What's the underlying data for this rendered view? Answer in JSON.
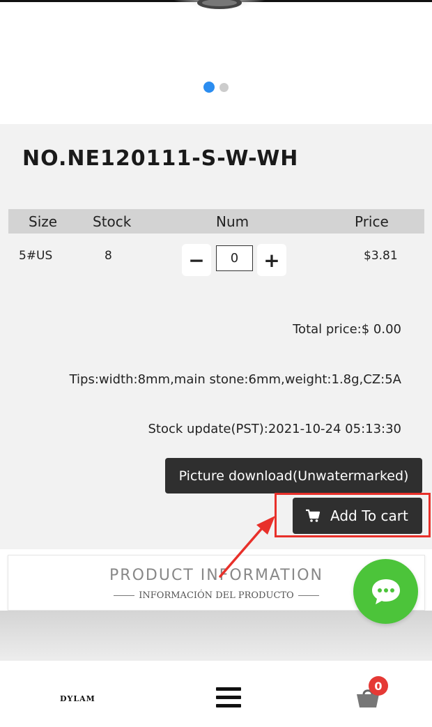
{
  "carousel": {
    "active_color": "#2b8df0",
    "inactive_color": "#cccccc"
  },
  "product": {
    "sku": "NO.NE120111-S-W-WH"
  },
  "table": {
    "headers": {
      "size": "Size",
      "stock": "Stock",
      "num": "Num",
      "price": "Price"
    },
    "row": {
      "size": "5#US",
      "stock": "8",
      "num": "0",
      "price": "$3.81"
    },
    "minus": "−",
    "plus": "+"
  },
  "totals": {
    "total_price": "Total price:$ 0.00",
    "tips": "Tips:width:8mm,main stone:6mm,weight:1.8g,CZ:5A",
    "stock_update": "Stock update(PST):2021-10-24 05:13:30"
  },
  "buttons": {
    "picture_download": "Picture download(Unwatermarked)",
    "add_to_cart": "Add To cart"
  },
  "info_section": {
    "title": "PRODUCT INFORMATION",
    "subtitle": "INFORMACIÓN DEL PRODUCTO"
  },
  "nav": {
    "logo": "DYLAM",
    "cart_count": "0"
  },
  "colors": {
    "highlight": "#e8302a",
    "chat_green": "#4cc43a",
    "badge_red": "#e53935"
  },
  "icons": [
    "cart-icon",
    "chat-icon",
    "menu-icon",
    "shopping-bag-icon",
    "minus-icon",
    "plus-icon"
  ]
}
